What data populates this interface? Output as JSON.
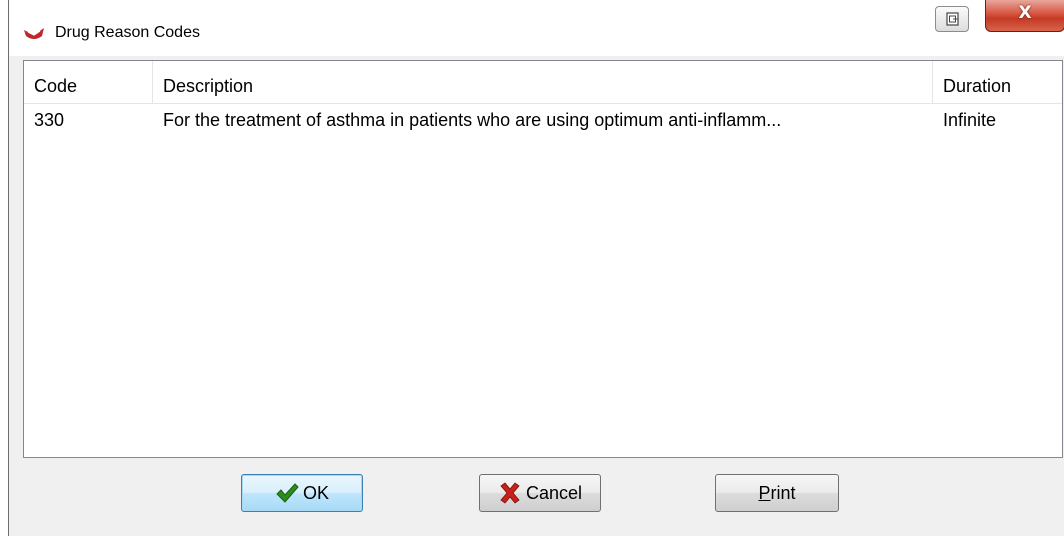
{
  "window": {
    "title": "Drug Reason Codes",
    "close_glyph": "X"
  },
  "icons": {
    "app": "pill-icon",
    "restore": "restore-icon",
    "ok": "checkmark-icon",
    "cancel": "red-x-icon"
  },
  "colors": {
    "app_icon": "#c0272d",
    "ok_check": "#2e8b1e",
    "cancel_x": "#c8201a",
    "close_button": "#c33a25",
    "default_button_border": "#3c7fb1"
  },
  "table": {
    "columns": [
      "Code",
      "Description",
      "Duration"
    ],
    "rows": [
      {
        "code": "330",
        "description": "For the treatment of asthma in patients who are using optimum anti-inflamm...",
        "duration": "Infinite"
      }
    ]
  },
  "buttons": {
    "ok": "OK",
    "cancel": "Cancel",
    "print": "Print"
  }
}
